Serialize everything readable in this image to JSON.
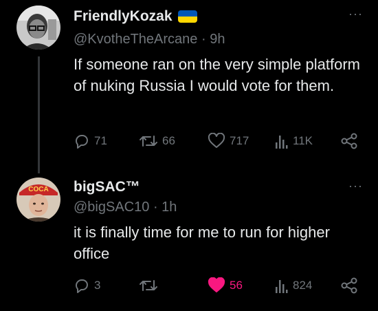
{
  "tweets": [
    {
      "display_name": "FriendlyKozak",
      "badge": "ukraine-flag",
      "handle": "@KvotheTheArcane",
      "time": "9h",
      "text": "If someone ran on the very simple platform of nuking Russia I would vote for them.",
      "avatar_icon": "profile-photo",
      "stats": {
        "replies": "71",
        "retweets": "66",
        "likes": "717",
        "views": "11K"
      },
      "liked": false
    },
    {
      "display_name": "bigSAC™",
      "handle": "@bigSAC10",
      "time": "1h",
      "text": "it is finally time for me to run for higher office",
      "avatar_icon": "profile-photo-coca-hat",
      "avatar_text": "COCA",
      "stats": {
        "replies": "3",
        "retweets": "",
        "likes": "56",
        "views": "824"
      },
      "liked": true
    }
  ],
  "separator": "·",
  "more_label": "···",
  "colors": {
    "background": "#000000",
    "text": "#e7e9ea",
    "secondary": "#71767b",
    "like_pink": "#f91880",
    "flag_blue": "#0057b7",
    "flag_yellow": "#ffd700"
  },
  "icons": [
    "reply-icon",
    "retweet-icon",
    "like-icon",
    "views-icon",
    "share-icon",
    "more-icon"
  ]
}
